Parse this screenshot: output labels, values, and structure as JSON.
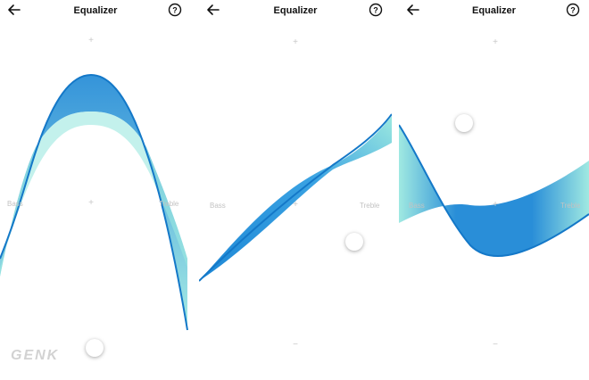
{
  "screens": [
    {
      "title": "Equalizer",
      "bass_label": "Bass",
      "treble_label": "Treble",
      "plus": "+",
      "minus": "−",
      "center": "+"
    },
    {
      "title": "Equalizer",
      "bass_label": "Bass",
      "treble_label": "Treble",
      "plus": "+",
      "minus": "−",
      "center": "+"
    },
    {
      "title": "Equalizer",
      "bass_label": "Bass",
      "treble_label": "Treble",
      "plus": "+",
      "minus": "−",
      "center": "+"
    }
  ],
  "watermark": "GENK",
  "colors": {
    "curve_dark": "#1e88d6",
    "curve_light": "#9be8e0"
  },
  "icons": [
    "back-arrow-icon",
    "help-icon"
  ]
}
